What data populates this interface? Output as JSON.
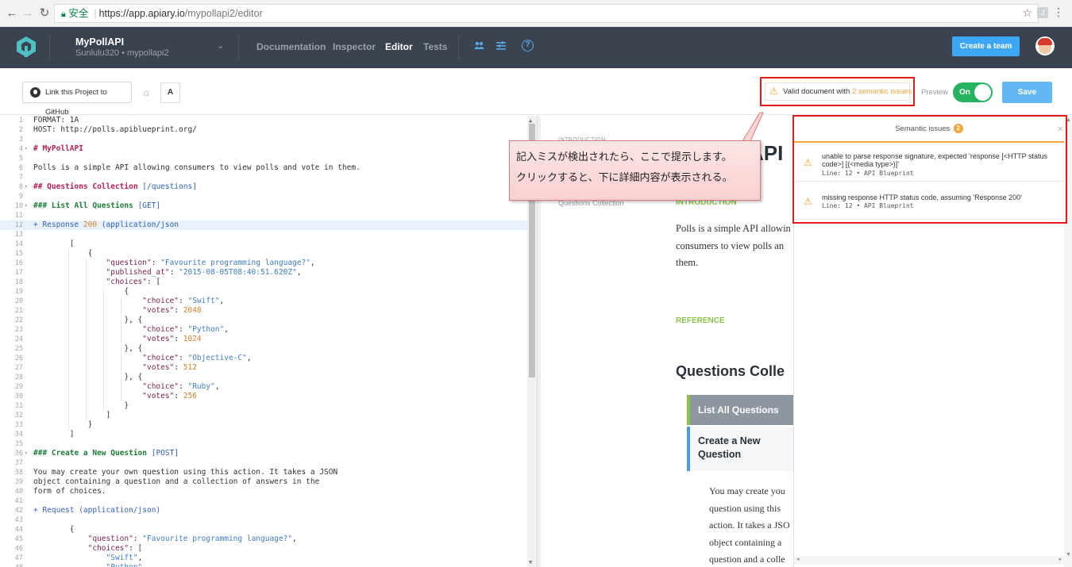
{
  "browser": {
    "secure_label": "安全",
    "url_scheme_host": "https://app.apiary.io",
    "url_path": "/mypollapi2/editor"
  },
  "header": {
    "project_name": "MyPollAPI",
    "project_sub": "Sunlulu320 • mypollapi2",
    "nav": [
      "Documentation",
      "Inspector",
      "Editor",
      "Tests"
    ],
    "active_nav": "Editor",
    "create_team": "Create a team",
    "help_glyph": "?"
  },
  "toolbar": {
    "github_label": "Link this Project to GitHub",
    "font_label": "A",
    "valid_prefix": "Valid document with ",
    "valid_issues": "2 semantic issues",
    "preview_label": "Preview",
    "toggle_label": "On",
    "save_label": "Save"
  },
  "editor": {
    "lines": [
      {
        "n": "1",
        "fold": "",
        "segs": [
          [
            "FORMAT: 1A",
            ""
          ]
        ]
      },
      {
        "n": "2",
        "fold": "",
        "segs": [
          [
            "HOST: http://polls.apiblueprint.org/",
            ""
          ]
        ]
      },
      {
        "n": "3",
        "fold": "",
        "segs": []
      },
      {
        "n": "4",
        "fold": "▾",
        "segs": [
          [
            "# MyPollAPI",
            "c-head"
          ]
        ]
      },
      {
        "n": "5",
        "fold": "",
        "segs": []
      },
      {
        "n": "6",
        "fold": "",
        "segs": [
          [
            "Polls is a simple API allowing consumers to view polls and vote in them.",
            ""
          ]
        ]
      },
      {
        "n": "7",
        "fold": "",
        "segs": []
      },
      {
        "n": "8",
        "fold": "▾",
        "segs": [
          [
            "## Questions Collection ",
            "c-head"
          ],
          [
            "[/questions]",
            "c-link"
          ]
        ]
      },
      {
        "n": "9",
        "fold": "",
        "segs": []
      },
      {
        "n": "10",
        "fold": "▾",
        "segs": [
          [
            "### List All Questions ",
            "c-green"
          ],
          [
            "[GET]",
            "c-link"
          ]
        ]
      },
      {
        "n": "11",
        "fold": "",
        "segs": []
      },
      {
        "n": "12",
        "fold": "",
        "hl": true,
        "segs": [
          [
            "+ Response ",
            "c-plus"
          ],
          [
            "200",
            "c-num"
          ],
          [
            " (application/json",
            "c-str2"
          ]
        ]
      },
      {
        "n": "13",
        "fold": "",
        "segs": []
      },
      {
        "n": "14",
        "fold": "",
        "segs": [
          [
            "        [",
            ""
          ]
        ]
      },
      {
        "n": "15",
        "fold": "",
        "segs": [
          [
            "            {",
            ""
          ]
        ]
      },
      {
        "n": "16",
        "fold": "",
        "segs": [
          [
            "                \"question\"",
            "c-key"
          ],
          [
            ": ",
            ""
          ],
          [
            "\"Favourite programming language?\"",
            "c-str"
          ],
          [
            ",",
            ""
          ]
        ]
      },
      {
        "n": "17",
        "fold": "",
        "segs": [
          [
            "                \"published_at\"",
            "c-key"
          ],
          [
            ": ",
            ""
          ],
          [
            "\"2015-08-05T08:40:51.620Z\"",
            "c-str"
          ],
          [
            ",",
            ""
          ]
        ]
      },
      {
        "n": "18",
        "fold": "",
        "segs": [
          [
            "                \"choices\"",
            "c-key"
          ],
          [
            ": [",
            ""
          ]
        ]
      },
      {
        "n": "19",
        "fold": "",
        "segs": [
          [
            "                    {",
            ""
          ]
        ]
      },
      {
        "n": "20",
        "fold": "",
        "segs": [
          [
            "                        \"choice\"",
            "c-key"
          ],
          [
            ": ",
            ""
          ],
          [
            "\"Swift\"",
            "c-str"
          ],
          [
            ",",
            ""
          ]
        ]
      },
      {
        "n": "21",
        "fold": "",
        "segs": [
          [
            "                        \"votes\"",
            "c-key"
          ],
          [
            ": ",
            ""
          ],
          [
            "2048",
            "c-num"
          ]
        ]
      },
      {
        "n": "22",
        "fold": "",
        "segs": [
          [
            "                    }, {",
            ""
          ]
        ]
      },
      {
        "n": "23",
        "fold": "",
        "segs": [
          [
            "                        \"choice\"",
            "c-key"
          ],
          [
            ": ",
            ""
          ],
          [
            "\"Python\"",
            "c-str"
          ],
          [
            ",",
            ""
          ]
        ]
      },
      {
        "n": "24",
        "fold": "",
        "segs": [
          [
            "                        \"votes\"",
            "c-key"
          ],
          [
            ": ",
            ""
          ],
          [
            "1024",
            "c-num"
          ]
        ]
      },
      {
        "n": "25",
        "fold": "",
        "segs": [
          [
            "                    }, {",
            ""
          ]
        ]
      },
      {
        "n": "26",
        "fold": "",
        "segs": [
          [
            "                        \"choice\"",
            "c-key"
          ],
          [
            ": ",
            ""
          ],
          [
            "\"Objective-C\"",
            "c-str"
          ],
          [
            ",",
            ""
          ]
        ]
      },
      {
        "n": "27",
        "fold": "",
        "segs": [
          [
            "                        \"votes\"",
            "c-key"
          ],
          [
            ": ",
            ""
          ],
          [
            "512",
            "c-num"
          ]
        ]
      },
      {
        "n": "28",
        "fold": "",
        "segs": [
          [
            "                    }, {",
            ""
          ]
        ]
      },
      {
        "n": "29",
        "fold": "",
        "segs": [
          [
            "                        \"choice\"",
            "c-key"
          ],
          [
            ": ",
            ""
          ],
          [
            "\"Ruby\"",
            "c-str"
          ],
          [
            ",",
            ""
          ]
        ]
      },
      {
        "n": "30",
        "fold": "",
        "segs": [
          [
            "                        \"votes\"",
            "c-key"
          ],
          [
            ": ",
            ""
          ],
          [
            "256",
            "c-num"
          ]
        ]
      },
      {
        "n": "31",
        "fold": "",
        "segs": [
          [
            "                    }",
            ""
          ]
        ]
      },
      {
        "n": "32",
        "fold": "",
        "segs": [
          [
            "                ]",
            ""
          ]
        ]
      },
      {
        "n": "33",
        "fold": "",
        "segs": [
          [
            "            }",
            ""
          ]
        ]
      },
      {
        "n": "34",
        "fold": "",
        "segs": [
          [
            "        ]",
            ""
          ]
        ]
      },
      {
        "n": "35",
        "fold": "",
        "segs": []
      },
      {
        "n": "36",
        "fold": "▾",
        "segs": [
          [
            "### Create a New Question ",
            "c-green"
          ],
          [
            "[POST]",
            "c-link"
          ]
        ]
      },
      {
        "n": "37",
        "fold": "",
        "segs": []
      },
      {
        "n": "38",
        "fold": "",
        "segs": [
          [
            "You may create your own question using this action. It takes a JSON",
            ""
          ]
        ]
      },
      {
        "n": "39",
        "fold": "",
        "segs": [
          [
            "object containing a question and a collection of answers in the",
            ""
          ]
        ]
      },
      {
        "n": "40",
        "fold": "",
        "segs": [
          [
            "form of choices.",
            ""
          ]
        ]
      },
      {
        "n": "41",
        "fold": "",
        "segs": []
      },
      {
        "n": "42",
        "fold": "",
        "segs": [
          [
            "+ Request (application/json)",
            "c-plus"
          ]
        ]
      },
      {
        "n": "43",
        "fold": "",
        "segs": []
      },
      {
        "n": "44",
        "fold": "",
        "segs": [
          [
            "        {",
            ""
          ]
        ]
      },
      {
        "n": "45",
        "fold": "",
        "segs": [
          [
            "            \"question\"",
            "c-key"
          ],
          [
            ": ",
            ""
          ],
          [
            "\"Favourite programming language?\"",
            "c-str"
          ],
          [
            ",",
            ""
          ]
        ]
      },
      {
        "n": "46",
        "fold": "",
        "segs": [
          [
            "            \"choices\"",
            "c-key"
          ],
          [
            ": [",
            ""
          ]
        ]
      },
      {
        "n": "47",
        "fold": "",
        "segs": [
          [
            "                ",
            ""
          ],
          [
            "\"Swift\"",
            "c-str"
          ],
          [
            ",",
            ""
          ]
        ]
      },
      {
        "n": "48",
        "fold": "",
        "segs": [
          [
            "                ",
            ""
          ],
          [
            "\"Python\"",
            "c-str"
          ]
        ]
      }
    ]
  },
  "preview": {
    "intro_top": "INTRODUCTION",
    "toc_item": "Questions Collection",
    "title": "API",
    "intro_heading": "INTRODUCTION",
    "intro_lines": [
      "Polls is a simple API allowin",
      "consumers to view polls an",
      "them."
    ],
    "reference": "REFERENCE",
    "collection_heading": "Questions Colle",
    "card_list": "List All Questions",
    "card_create": "Create a New Question",
    "body_lines": [
      "You may create you",
      "question using this",
      "action. It takes a JSO",
      "object containing a",
      "question and a colle"
    ]
  },
  "callout": {
    "line1": "記入ミスが検出されたら、ここで提示します。",
    "line2": "クリックすると、下に詳細内容が表示される。"
  },
  "semantic": {
    "title": "Semantic issues",
    "count": "2",
    "issues": [
      {
        "message": "unable to parse response signature, expected 'response [<HTTP status code>] [(<media type>)]'",
        "meta": "Line: 12 • API Blueprint"
      },
      {
        "message": "missing response HTTP status code, assuming 'Response 200'",
        "meta": "Line: 12 • API Blueprint"
      }
    ]
  },
  "colors": {
    "header_bg": "#3b4250",
    "accent_blue": "#3ea7f5",
    "toggle_green": "#26b35f",
    "warning_orange": "#f3a53a",
    "annotation_red": "#e21a1a"
  }
}
